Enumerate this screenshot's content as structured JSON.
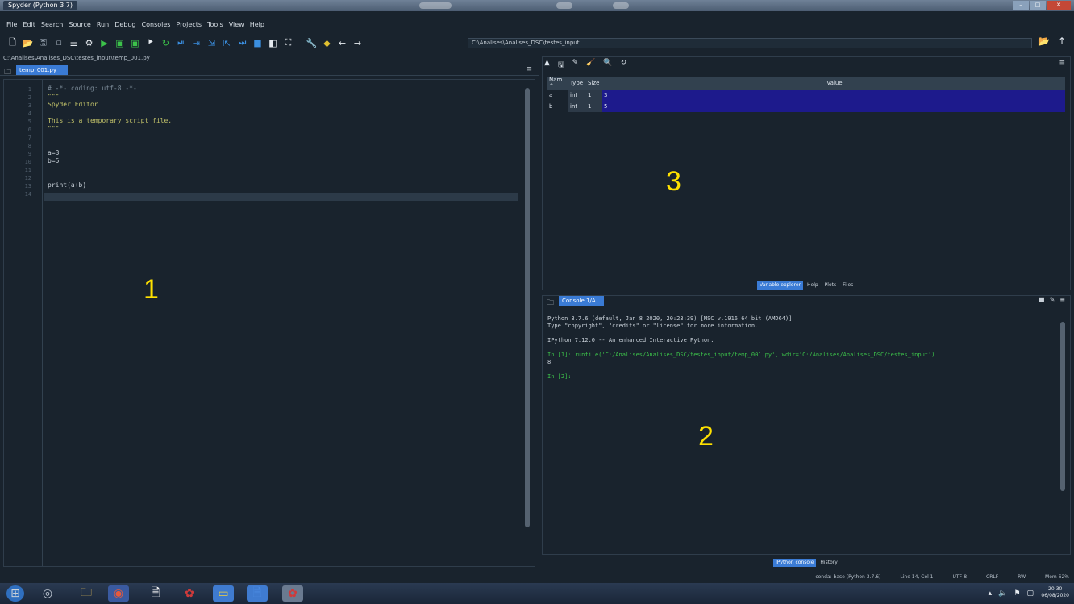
{
  "titlebar": {
    "title": "Spyder (Python 3.7)"
  },
  "menu": [
    "File",
    "Edit",
    "Search",
    "Source",
    "Run",
    "Debug",
    "Consoles",
    "Projects",
    "Tools",
    "View",
    "Help"
  ],
  "toolbar": {
    "path": "C:\\Analises\\Analises_DSC\\testes_input"
  },
  "editor": {
    "filepath": "C:\\Analises\\Analises_DSC\\testes_input\\temp_001.py",
    "tab": "temp_001.py",
    "lines": [
      {
        "n": "1",
        "t": "# -*- coding: utf-8 -*-",
        "c": "#7a8a97"
      },
      {
        "n": "2",
        "t": "\"\"\"",
        "c": "#c3c36a"
      },
      {
        "n": "3",
        "t": "Spyder Editor",
        "c": "#c3c36a"
      },
      {
        "n": "4",
        "t": "",
        "c": "#c3c36a"
      },
      {
        "n": "5",
        "t": "This is a temporary script file.",
        "c": "#c3c36a"
      },
      {
        "n": "6",
        "t": "\"\"\"",
        "c": "#c3c36a"
      },
      {
        "n": "7",
        "t": "",
        "c": "#c8d0d8"
      },
      {
        "n": "8",
        "t": "",
        "c": "#c8d0d8"
      },
      {
        "n": "9",
        "t": "a=3",
        "c": "#c8d0d8"
      },
      {
        "n": "10",
        "t": "b=5",
        "c": "#c8d0d8"
      },
      {
        "n": "11",
        "t": "",
        "c": "#c8d0d8"
      },
      {
        "n": "12",
        "t": "",
        "c": "#c8d0d8"
      },
      {
        "n": "13",
        "t": "print(a+b)",
        "c": "#c8d0d8"
      },
      {
        "n": "14",
        "t": "",
        "c": "#c8d0d8"
      }
    ],
    "label": "1"
  },
  "variable_explorer": {
    "headers": [
      "Nam ^",
      "Type",
      "Size",
      "Value"
    ],
    "rows": [
      {
        "name": "a",
        "type": "int",
        "size": "1",
        "value": "3"
      },
      {
        "name": "b",
        "type": "int",
        "size": "1",
        "value": "5"
      }
    ],
    "tabs": [
      "Variable explorer",
      "Help",
      "Plots",
      "Files"
    ],
    "label": "3"
  },
  "console": {
    "tab": "Console 1/A",
    "lines": [
      {
        "t": "Python 3.7.6 (default, Jan  8 2020, 20:23:39) [MSC v.1916 64 bit (AMD64)]",
        "g": false
      },
      {
        "t": "Type \"copyright\", \"credits\" or \"license\" for more information.",
        "g": false
      },
      {
        "t": "",
        "g": false
      },
      {
        "t": "IPython 7.12.0 -- An enhanced Interactive Python.",
        "g": false
      },
      {
        "t": "",
        "g": false
      },
      {
        "t": "In [1]: runfile('C:/Analises/Analises_DSC/testes_input/temp_001.py', wdir='C:/Analises/Analises_DSC/testes_input')",
        "g": true
      },
      {
        "t": "8",
        "g": false
      },
      {
        "t": "",
        "g": false
      },
      {
        "t": "In [2]:",
        "g": true
      }
    ],
    "tabs": [
      "IPython console",
      "History"
    ],
    "label": "2"
  },
  "statusbar": [
    "conda: base (Python 3.7.6)",
    "Line 14, Col 1",
    "UTF-8",
    "CRLF",
    "RW",
    "Mem 62%"
  ],
  "taskbar": {
    "clock_time": "20:30",
    "clock_date": "06/08/2020"
  }
}
